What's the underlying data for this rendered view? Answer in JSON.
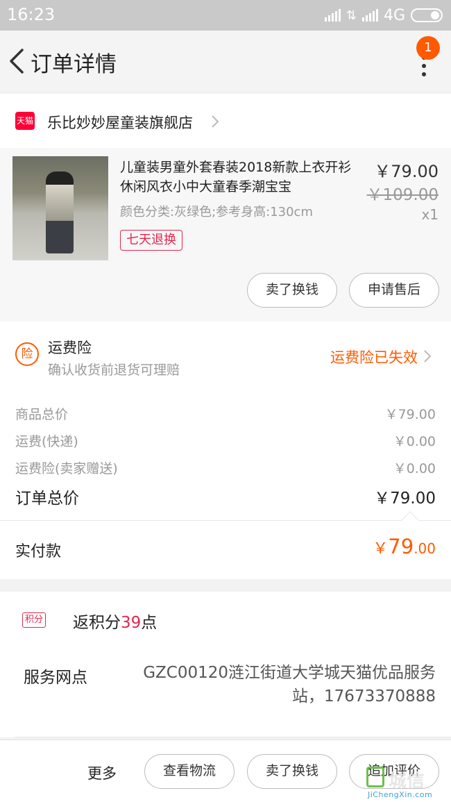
{
  "status_bar": {
    "time": "16:23",
    "network": "4G"
  },
  "nav": {
    "title": "订单详情",
    "badge_count": "1"
  },
  "shop": {
    "platform_label": "天猫",
    "name": "乐比妙妙屋童装旗舰店"
  },
  "product": {
    "title": "儿童装男童外套春装2018新款上衣开衫休闲风衣小中大童春季潮宝宝",
    "props": "颜色分类:灰绿色;参考身高:130cm",
    "tag": "七天退换",
    "price": "￥79.00",
    "original_price": "￥109.00",
    "quantity": "x1",
    "actions": {
      "sell": "卖了换钱",
      "after_sale": "申请售后"
    }
  },
  "insurance": {
    "icon_label": "险",
    "title": "运费险",
    "subtitle": "确认收货前退货可理赔",
    "status": "运费险已失效",
    "status_color": "#ff5a00"
  },
  "summary": {
    "rows": [
      {
        "label": "商品总价",
        "value": "￥79.00"
      },
      {
        "label": "运费(快递)",
        "value": "￥0.00"
      },
      {
        "label": "运费险(卖家赠送)",
        "value": "￥0.00"
      }
    ],
    "total_label": "订单总价",
    "total_value": "￥79.00"
  },
  "paid": {
    "label": "实付款",
    "currency": "￥",
    "int": "79",
    "dec": ".00"
  },
  "points": {
    "tag": "积分",
    "prefix": "返积分",
    "value": "39",
    "suffix": "点",
    "service_label": "服务网点",
    "service_value": "GZC00120涟江街道大学城天猫优品服务站，17673370888"
  },
  "bottom_bar": {
    "more": "更多",
    "buttons": [
      "查看物流",
      "卖了换钱",
      "追加评价"
    ]
  },
  "watermark": {
    "cn": "城信",
    "en": "JiChengXin.com"
  },
  "colors": {
    "accent": "#ff5a00",
    "tmall_red": "#ff0036",
    "tag_red": "#e0284f"
  }
}
